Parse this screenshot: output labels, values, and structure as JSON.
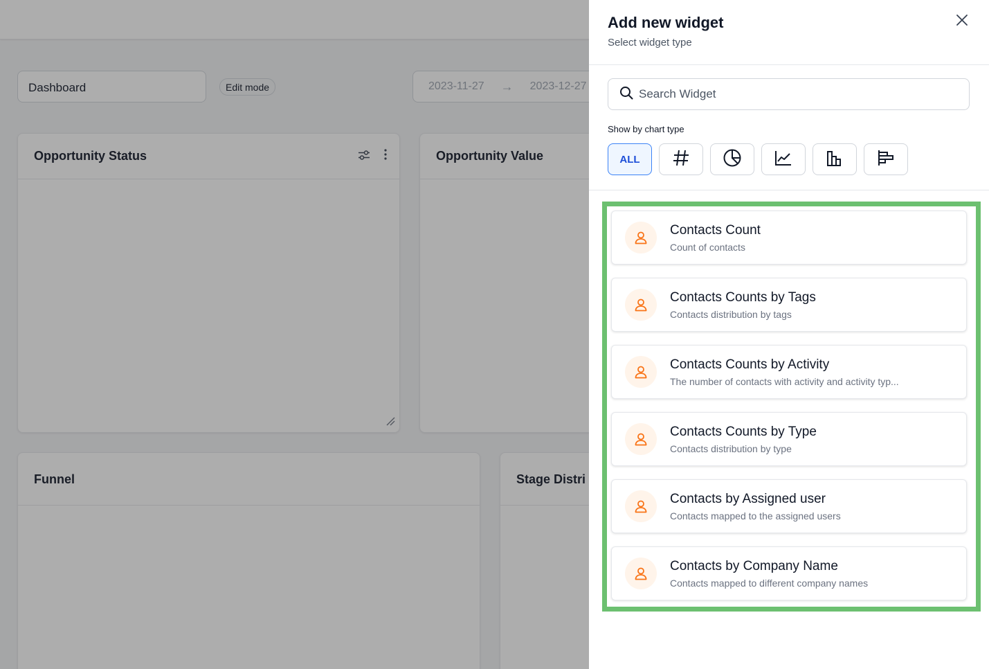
{
  "dashboard": {
    "name": "Dashboard",
    "mode_badge": "Edit mode",
    "date_start": "2023-11-27",
    "date_end": "2023-12-27",
    "cards": {
      "opportunity_status": "Opportunity Status",
      "opportunity_value": "Opportunity Value",
      "funnel": "Funnel",
      "stage_distribution": "Stage Distri"
    }
  },
  "drawer": {
    "title": "Add new widget",
    "subtitle": "Select widget type",
    "search_placeholder": "Search Widget",
    "chart_type_label": "Show by chart type",
    "chart_types": [
      {
        "label": "ALL",
        "icon": "all",
        "active": true
      },
      {
        "label": "",
        "icon": "hash-icon"
      },
      {
        "label": "",
        "icon": "pie-chart-icon"
      },
      {
        "label": "",
        "icon": "line-chart-icon"
      },
      {
        "label": "",
        "icon": "bar-chart-icon"
      },
      {
        "label": "",
        "icon": "horizontal-bar-chart-icon"
      }
    ],
    "widgets": [
      {
        "title": "Contacts Count",
        "description": "Count of contacts"
      },
      {
        "title": "Contacts Counts by Tags",
        "description": "Contacts distribution by tags"
      },
      {
        "title": "Contacts Counts by Activity",
        "description": "The number of contacts with activity and activity typ..."
      },
      {
        "title": "Contacts Counts by Type",
        "description": "Contacts distribution by type"
      },
      {
        "title": "Contacts by Assigned user",
        "description": "Contacts mapped to the assigned users"
      },
      {
        "title": "Contacts by Company Name",
        "description": "Contacts mapped to different company names"
      }
    ]
  },
  "colors": {
    "highlight_border": "#6cc070",
    "accent": "#3b82f6",
    "contact_icon": "#f97316",
    "contact_icon_bg": "#fff4ea"
  }
}
